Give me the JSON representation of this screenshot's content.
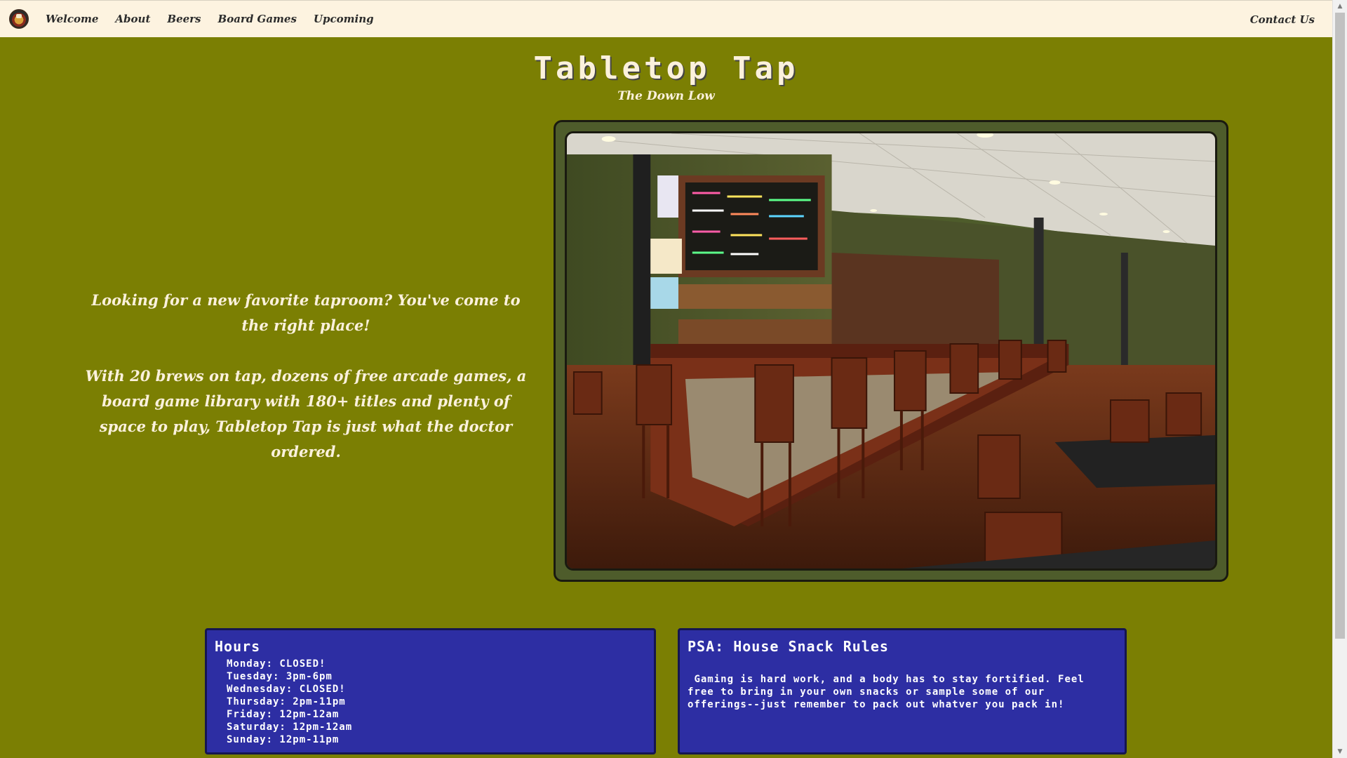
{
  "nav": {
    "logo_icon": "tabletop-tap-logo-icon",
    "links": [
      "Welcome",
      "About",
      "Beers",
      "Board Games",
      "Upcoming"
    ],
    "contact": "Contact Us"
  },
  "header": {
    "title": "Tabletop Tap",
    "subtitle": "The Down Low"
  },
  "intro": {
    "paragraph1": "Looking for a new favorite taproom? You've come to the right place!",
    "paragraph2": "With 20 brews on tap, dozens of free arcade games, a board game library with 180+ titles and plenty of space to play, Tabletop Tap is just what the doctor ordered."
  },
  "hours": {
    "title": "Hours",
    "days": [
      "Monday: CLOSED!",
      "Tuesday: 3pm-6pm",
      "Wednesday: CLOSED!",
      "Thursday: 2pm-11pm",
      "Friday: 12pm-12am",
      "Saturday: 12pm-12am",
      "Sunday: 12pm-11pm"
    ]
  },
  "psa": {
    "title": "PSA: House Snack Rules",
    "text": " Gaming is hard work, and a body has to stay fortified. Feel free to bring in your own snacks or sample some of our offerings--just remember to pack out whatver you pack in!"
  },
  "colors": {
    "page_bg": "#7b7f03",
    "nav_bg": "#fdf3e0",
    "box_bg": "#2d2ea3",
    "frame_bg": "#4e5c2b",
    "text_light": "#fbf1dc"
  }
}
